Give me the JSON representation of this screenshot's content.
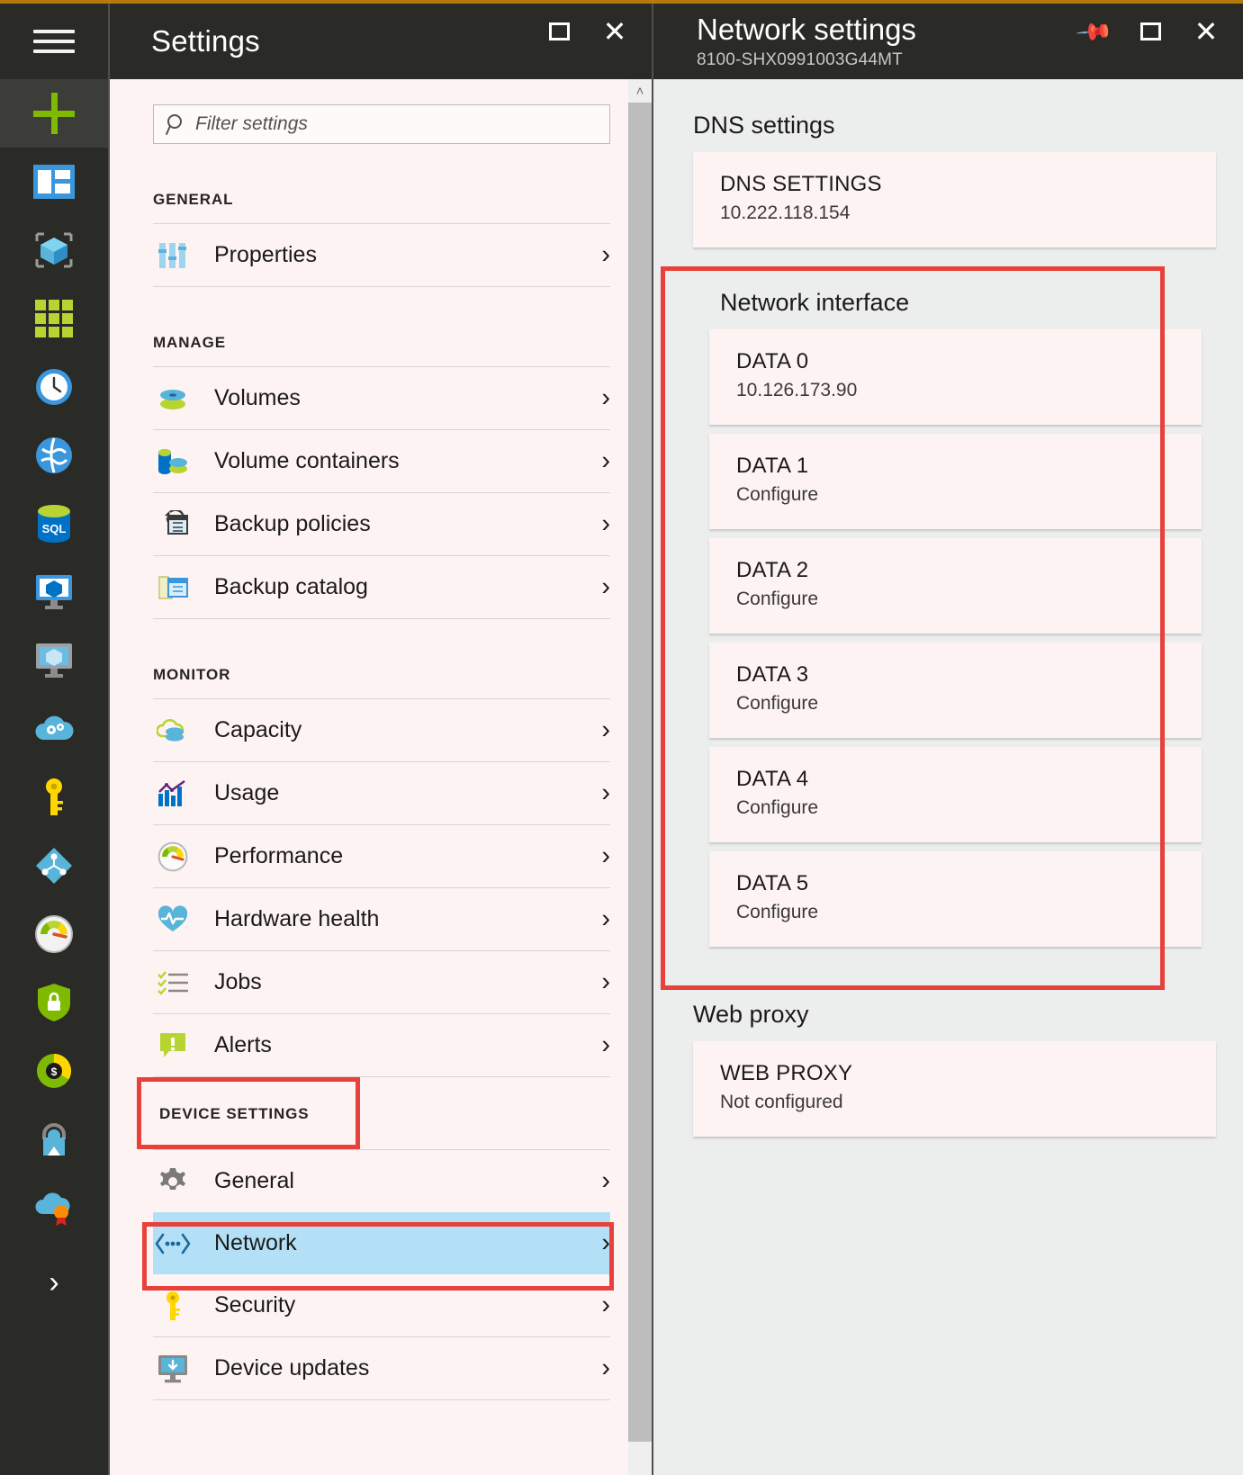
{
  "theme": {
    "accent_top": "#b5790c",
    "highlight_red": "#e8403a",
    "selected_row_blue": "#b3e0f7",
    "blade_bg": "#fdf3f3",
    "net_blade_bg": "#eceded",
    "header_bg": "#2a2a27"
  },
  "nav_rail": {
    "items": [
      {
        "name": "hamburger-menu",
        "icon": "hamburger-icon"
      },
      {
        "name": "new-resource",
        "icon": "plus-icon"
      },
      {
        "name": "dashboard",
        "icon": "dashboard-icon"
      },
      {
        "name": "all-resources",
        "icon": "cube-icon"
      },
      {
        "name": "resource-groups",
        "icon": "grid-icon"
      },
      {
        "name": "recent",
        "icon": "clock-icon"
      },
      {
        "name": "app-services",
        "icon": "globe-icon"
      },
      {
        "name": "sql-databases",
        "icon": "sql-icon"
      },
      {
        "name": "virtual-machines-classic",
        "icon": "monitor-cube-icon"
      },
      {
        "name": "virtual-machines",
        "icon": "monitor-cube-gray-icon"
      },
      {
        "name": "cloud-services",
        "icon": "cloud-gears-icon"
      },
      {
        "name": "subscriptions",
        "icon": "key-icon"
      },
      {
        "name": "azure-active-directory",
        "icon": "diamond-node-icon"
      },
      {
        "name": "monitor",
        "icon": "gauge-icon"
      },
      {
        "name": "security-center",
        "icon": "shield-lock-icon"
      },
      {
        "name": "billing",
        "icon": "donut-dollar-icon"
      },
      {
        "name": "help-and-support",
        "icon": "lock-person-icon"
      },
      {
        "name": "compliance",
        "icon": "cloud-badge-icon"
      },
      {
        "name": "expand-more",
        "icon": "chevron-right-icon"
      }
    ]
  },
  "settings_blade": {
    "title": "Settings",
    "window_buttons": [
      {
        "name": "restore-button",
        "icon": "restore-icon"
      },
      {
        "name": "close-button",
        "icon": "close-icon"
      }
    ],
    "filter": {
      "placeholder": "Filter settings",
      "value": "",
      "icon": "search-icon"
    },
    "sections": [
      {
        "heading": "GENERAL",
        "highlighted": false,
        "items": [
          {
            "label": "Properties",
            "icon": "sliders-icon",
            "selected": false
          }
        ]
      },
      {
        "heading": "MANAGE",
        "highlighted": false,
        "items": [
          {
            "label": "Volumes",
            "icon": "volumes-icon",
            "selected": false
          },
          {
            "label": "Volume containers",
            "icon": "volume-containers-icon",
            "selected": false
          },
          {
            "label": "Backup policies",
            "icon": "backup-policies-icon",
            "selected": false
          },
          {
            "label": "Backup catalog",
            "icon": "backup-catalog-icon",
            "selected": false
          }
        ]
      },
      {
        "heading": "MONITOR",
        "highlighted": false,
        "items": [
          {
            "label": "Capacity",
            "icon": "capacity-icon",
            "selected": false
          },
          {
            "label": "Usage",
            "icon": "usage-chart-icon",
            "selected": false
          },
          {
            "label": "Performance",
            "icon": "performance-gauge-icon",
            "selected": false
          },
          {
            "label": "Hardware health",
            "icon": "heart-pulse-icon",
            "selected": false
          },
          {
            "label": "Jobs",
            "icon": "checklist-icon",
            "selected": false
          },
          {
            "label": "Alerts",
            "icon": "alert-icon",
            "selected": false
          }
        ]
      },
      {
        "heading": "DEVICE SETTINGS",
        "highlighted": true,
        "items": [
          {
            "label": "General",
            "icon": "gear-icon",
            "selected": false
          },
          {
            "label": "Network",
            "icon": "network-icon",
            "selected": true
          },
          {
            "label": "Security",
            "icon": "key-icon",
            "selected": false
          },
          {
            "label": "Device updates",
            "icon": "device-updates-icon",
            "selected": false
          }
        ]
      }
    ],
    "scrollbar": {
      "up_arrow": "˄"
    }
  },
  "network_blade": {
    "title": "Network settings",
    "subtitle": "8100-SHX0991003G44MT",
    "window_buttons": [
      {
        "name": "pin-button",
        "icon": "pin-icon"
      },
      {
        "name": "restore-button",
        "icon": "restore-icon"
      },
      {
        "name": "close-button",
        "icon": "close-icon"
      }
    ],
    "groups": [
      {
        "title": "DNS settings",
        "highlighted": false,
        "cards": [
          {
            "title": "DNS SETTINGS",
            "value": "10.222.118.154"
          }
        ]
      },
      {
        "title": "Network interface",
        "highlighted": true,
        "cards": [
          {
            "title": "DATA 0",
            "value": "10.126.173.90"
          },
          {
            "title": "DATA 1",
            "value": "Configure"
          },
          {
            "title": "DATA 2",
            "value": "Configure"
          },
          {
            "title": "DATA 3",
            "value": "Configure"
          },
          {
            "title": "DATA 4",
            "value": "Configure"
          },
          {
            "title": "DATA 5",
            "value": "Configure"
          }
        ]
      },
      {
        "title": "Web proxy",
        "highlighted": false,
        "cards": [
          {
            "title": "WEB PROXY",
            "value": "Not configured"
          }
        ]
      }
    ]
  }
}
